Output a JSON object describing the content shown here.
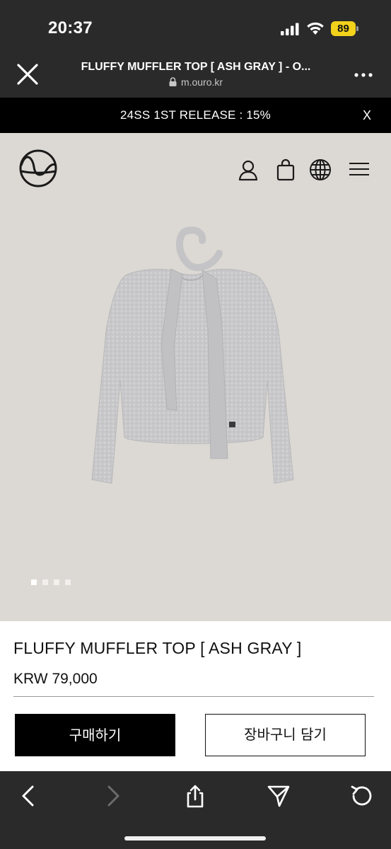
{
  "status_bar": {
    "time": "20:37",
    "battery_level": "89",
    "battery_color": "#f2d21b",
    "icons": [
      "signal-icon",
      "wifi-icon",
      "battery-icon"
    ]
  },
  "browser": {
    "page_title": "FLUFFY MUFFLER TOP [ ASH GRAY ] - O...",
    "url": "m.ouro.kr",
    "icons": [
      "close-icon",
      "lock-icon",
      "more-icon"
    ]
  },
  "announcement": {
    "text": "24SS 1ST RELEASE : 15%",
    "close_label": "X"
  },
  "site_header": {
    "icons": [
      "logo-icon",
      "user-icon",
      "bag-icon",
      "globe-icon",
      "menu-icon"
    ]
  },
  "gallery": {
    "slide_count": 4,
    "active_slide": 1
  },
  "product": {
    "name": "FLUFFY MUFFLER TOP [ ASH GRAY ]",
    "price": "KRW 79,000",
    "buy_label": "구매하기",
    "cart_label": "장바구니 담기"
  },
  "bottom_bar": {
    "icons": [
      "back-icon",
      "forward-icon",
      "share-icon",
      "send-icon",
      "refresh-icon"
    ]
  },
  "colors": {
    "bars": "#2a2a2a",
    "hero_bg": "#dcd8d3",
    "product_gray": "#c9c9cb",
    "buy_button": "#000000"
  }
}
